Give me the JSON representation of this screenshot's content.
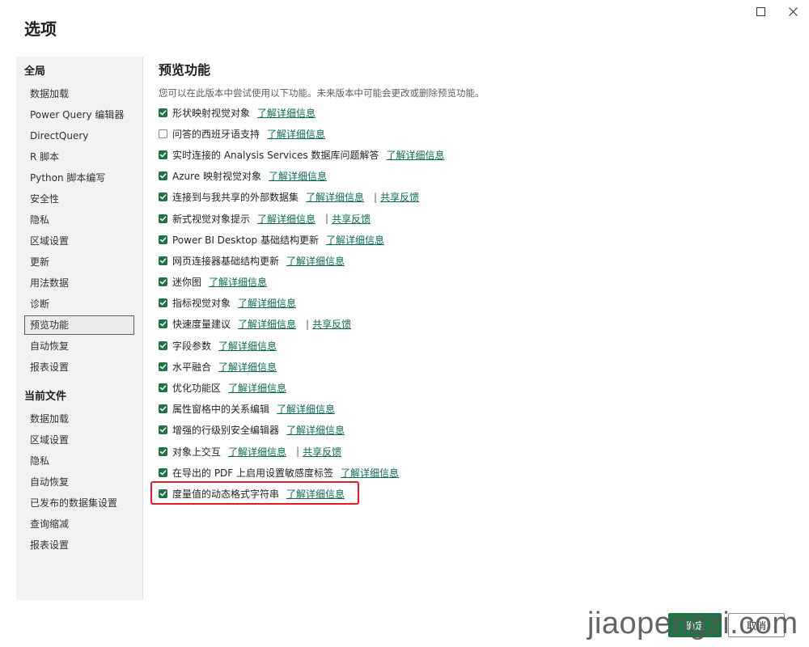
{
  "window": {
    "title": "选项"
  },
  "sidebar": {
    "global_header": "全局",
    "global_items": [
      "数据加载",
      "Power Query 编辑器",
      "DirectQuery",
      "R 脚本",
      "Python 脚本编写",
      "安全性",
      "隐私",
      "区域设置",
      "更新",
      "用法数据",
      "诊断",
      "预览功能",
      "自动恢复",
      "报表设置"
    ],
    "selected_item": "预览功能",
    "file_header": "当前文件",
    "file_items": [
      "数据加载",
      "区域设置",
      "隐私",
      "自动恢复",
      "已发布的数据集设置",
      "查询缩减",
      "报表设置"
    ]
  },
  "content": {
    "title": "预览功能",
    "description": "您可以在此版本中尝试使用以下功能。未来版本中可能会更改或删除预览功能。",
    "options": [
      {
        "label": "形状映射视觉对象",
        "checked": true,
        "link": "了解详细信息",
        "feedback": ""
      },
      {
        "label": "问答的西班牙语支持",
        "checked": false,
        "link": "了解详细信息",
        "feedback": ""
      },
      {
        "label": "实时连接的 Analysis Services 数据库问题解答",
        "checked": true,
        "link": "了解详细信息",
        "feedback": ""
      },
      {
        "label": "Azure 映射视觉对象",
        "checked": true,
        "link": "了解详细信息",
        "feedback": ""
      },
      {
        "label": "连接到与我共享的外部数据集",
        "checked": true,
        "link": "了解详细信息",
        "feedback": "共享反馈"
      },
      {
        "label": "新式视觉对象提示",
        "checked": true,
        "link": "了解详细信息",
        "feedback": "共享反馈"
      },
      {
        "label": "Power BI Desktop 基础结构更新",
        "checked": true,
        "link": "了解详细信息",
        "feedback": ""
      },
      {
        "label": "网页连接器基础结构更新",
        "checked": true,
        "link": "了解详细信息",
        "feedback": ""
      },
      {
        "label": "迷你图",
        "checked": true,
        "link": "了解详细信息",
        "feedback": ""
      },
      {
        "label": "指标视觉对象",
        "checked": true,
        "link": "了解详细信息",
        "feedback": ""
      },
      {
        "label": "快速度量建议",
        "checked": true,
        "link": "了解详细信息",
        "feedback": "共享反馈"
      },
      {
        "label": "字段参数",
        "checked": true,
        "link": "了解详细信息",
        "feedback": ""
      },
      {
        "label": "水平融合",
        "checked": true,
        "link": "了解详细信息",
        "feedback": ""
      },
      {
        "label": "优化功能区",
        "checked": true,
        "link": "了解详细信息",
        "feedback": ""
      },
      {
        "label": "属性窗格中的关系编辑",
        "checked": true,
        "link": "了解详细信息",
        "feedback": ""
      },
      {
        "label": "增强的行级别安全编辑器",
        "checked": true,
        "link": "了解详细信息",
        "feedback": ""
      },
      {
        "label": "对象上交互",
        "checked": true,
        "link": "了解详细信息",
        "feedback": "共享反馈"
      },
      {
        "label": "在导出的 PDF 上启用设置敏感度标签",
        "checked": true,
        "link": "了解详细信息",
        "feedback": ""
      },
      {
        "label": "度量值的动态格式字符串",
        "checked": true,
        "link": "了解详细信息",
        "feedback": ""
      }
    ],
    "separator": "|"
  },
  "footer": {
    "ok_label": "确定",
    "cancel_label": "取消"
  },
  "watermark": "jiaopengzi.com",
  "icons": {
    "maximize": "maximize-icon",
    "close": "close-icon",
    "check": "checkmark-icon"
  },
  "colors": {
    "accent": "#217346",
    "link": "#0b6a53",
    "highlight": "#e51c23"
  }
}
